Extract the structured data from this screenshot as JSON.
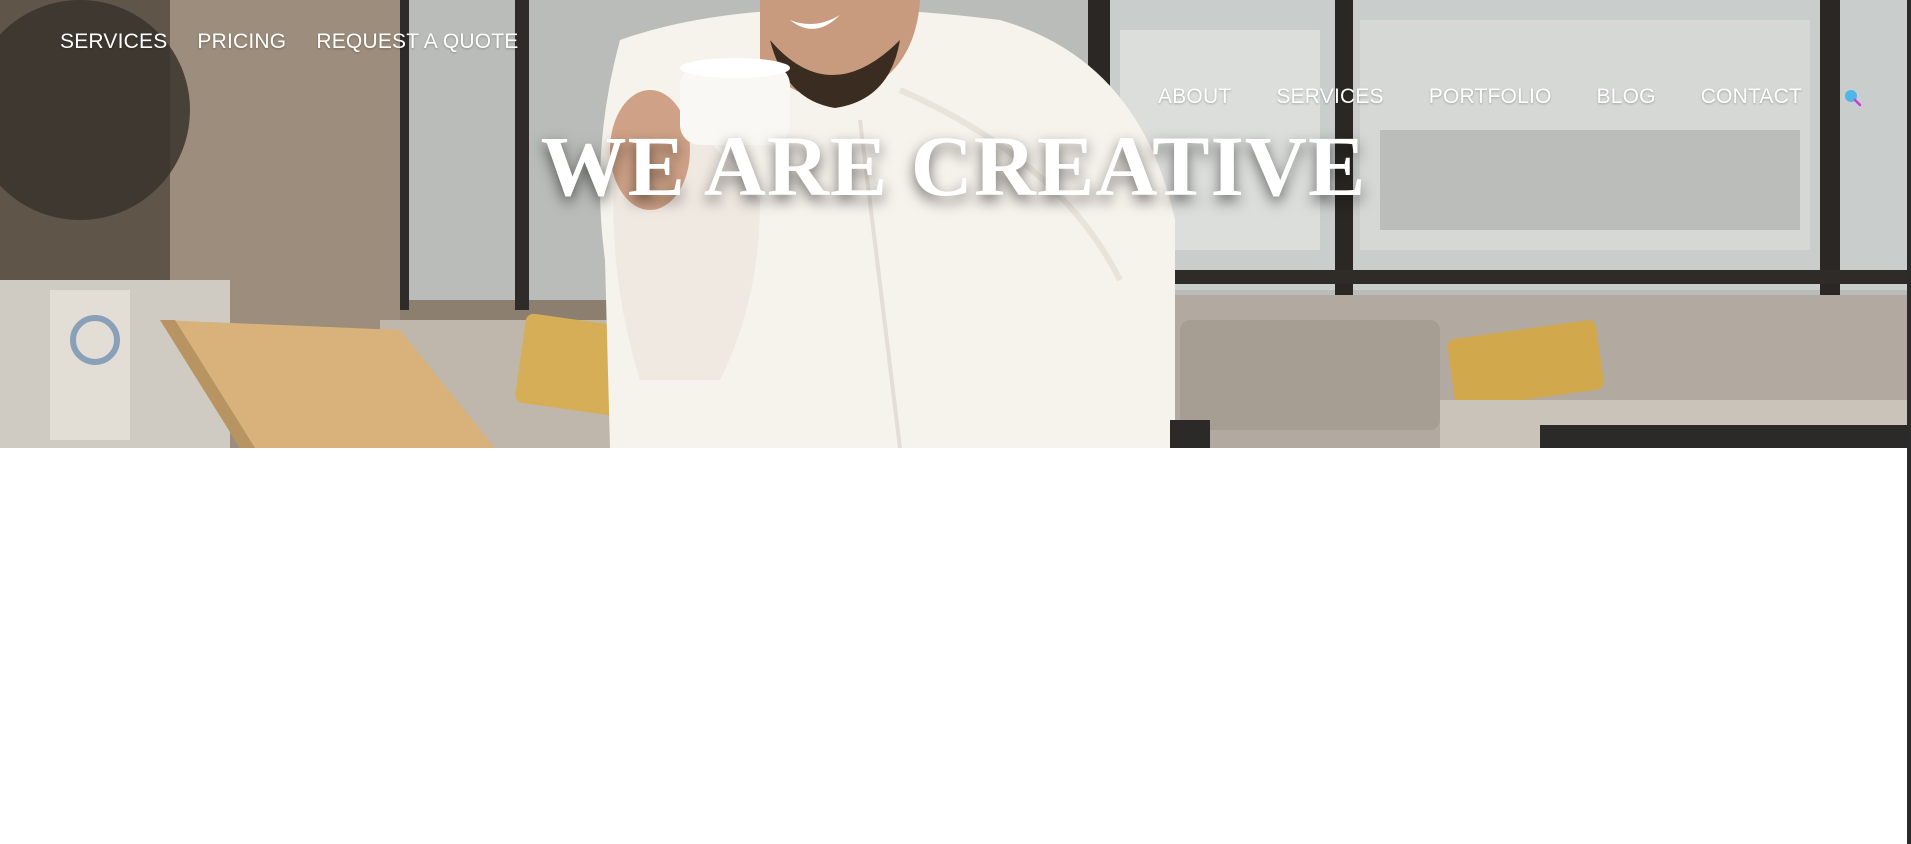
{
  "top_nav": {
    "items": [
      {
        "label": "SERVICES"
      },
      {
        "label": "PRICING"
      },
      {
        "label": "REQUEST A QUOTE"
      }
    ]
  },
  "main_nav": {
    "items": [
      {
        "label": "ABOUT"
      },
      {
        "label": "SERVICES"
      },
      {
        "label": "PORTFOLIO"
      },
      {
        "label": "BLOG"
      },
      {
        "label": "CONTACT"
      }
    ],
    "search_icon": "search-icon",
    "search_color": "#4fb6e8"
  },
  "hero": {
    "headline": "WE ARE CREATIVE",
    "background_image": "man-drinking-coffee-office"
  }
}
